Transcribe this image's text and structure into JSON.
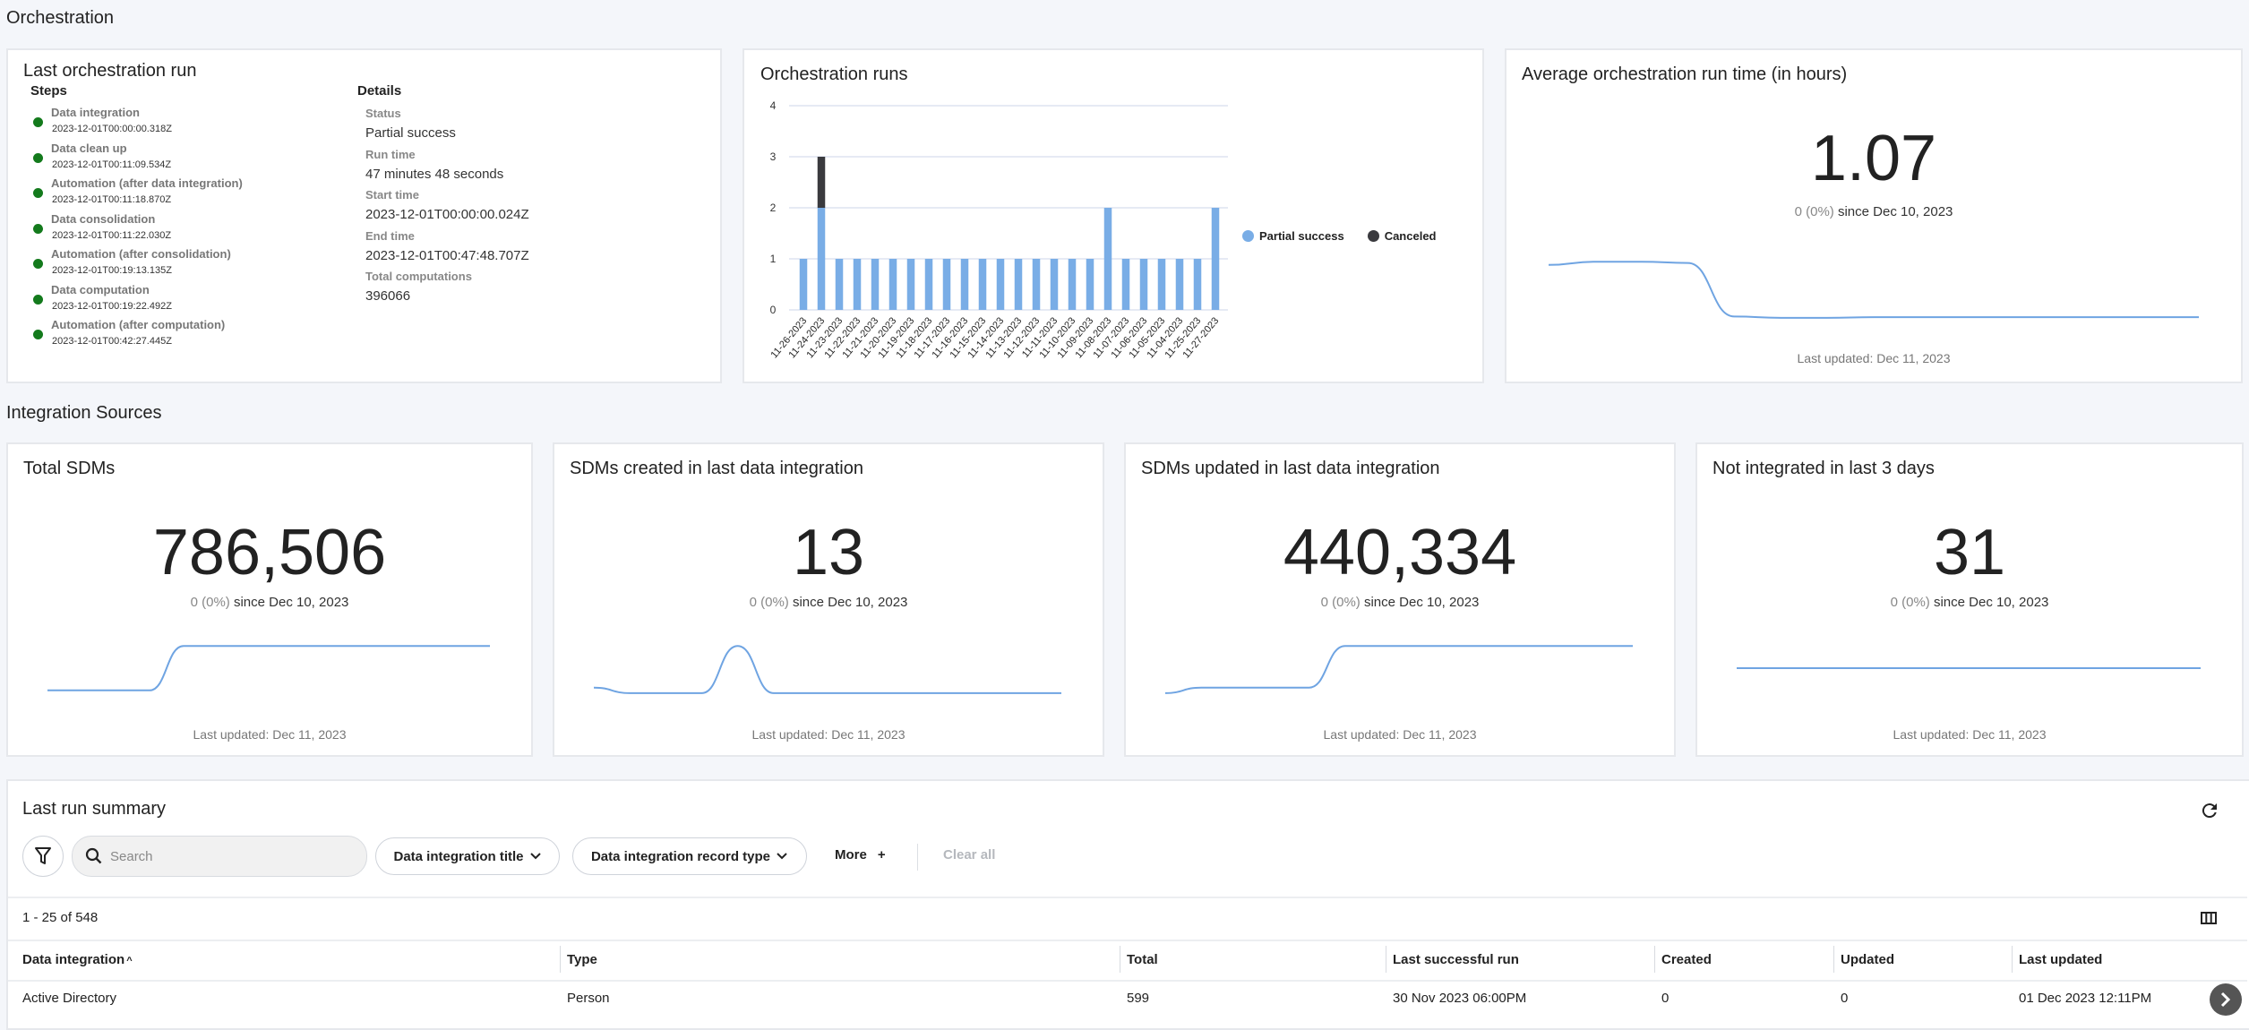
{
  "orchestration": {
    "section_title": "Orchestration",
    "last_run": {
      "title": "Last orchestration run",
      "steps_heading": "Steps",
      "steps": [
        {
          "name": "Data integration",
          "time": "2023-12-01T00:00:00.318Z",
          "status": "success"
        },
        {
          "name": "Data clean up",
          "time": "2023-12-01T00:11:09.534Z",
          "status": "success"
        },
        {
          "name": "Automation (after data integration)",
          "time": "2023-12-01T00:11:18.870Z",
          "status": "success"
        },
        {
          "name": "Data consolidation",
          "time": "2023-12-01T00:11:22.030Z",
          "status": "success"
        },
        {
          "name": "Automation (after consolidation)",
          "time": "2023-12-01T00:19:13.135Z",
          "status": "success"
        },
        {
          "name": "Data computation",
          "time": "2023-12-01T00:19:22.492Z",
          "status": "success"
        },
        {
          "name": "Automation (after computation)",
          "time": "2023-12-01T00:42:27.445Z",
          "status": "success"
        }
      ],
      "details_heading": "Details",
      "details": [
        {
          "label": "Status",
          "value": "Partial success"
        },
        {
          "label": "Run time",
          "value": "47 minutes 48 seconds"
        },
        {
          "label": "Start time",
          "value": "2023-12-01T00:00:00.024Z"
        },
        {
          "label": "End time",
          "value": "2023-12-01T00:47:48.707Z"
        },
        {
          "label": "Total computations",
          "value": "396066"
        }
      ]
    },
    "runs_chart_title": "Orchestration runs",
    "avg_runtime": {
      "title": "Average orchestration run time (in hours)",
      "value": "1.07",
      "delta": "0 (0%)",
      "since": "since Dec 10, 2023",
      "updated": "Last updated: Dec 11, 2023"
    }
  },
  "chart_data": {
    "type": "bar",
    "stacked": true,
    "title": "Orchestration runs",
    "xlabel": "",
    "ylabel": "",
    "ylim": [
      0,
      4
    ],
    "yticks": [
      0,
      1,
      2,
      3,
      4
    ],
    "grid": true,
    "legend_position": "right",
    "categories": [
      "11-26-2023",
      "11-24-2023",
      "11-23-2023",
      "11-22-2023",
      "11-21-2023",
      "11-20-2023",
      "11-19-2023",
      "11-18-2023",
      "11-17-2023",
      "11-16-2023",
      "11-15-2023",
      "11-14-2023",
      "11-13-2023",
      "11-12-2023",
      "11-11-2023",
      "11-10-2023",
      "11-09-2023",
      "11-08-2023",
      "11-07-2023",
      "11-06-2023",
      "11-05-2023",
      "11-04-2023",
      "11-25-2023",
      "11-27-2023"
    ],
    "series": [
      {
        "name": "Partial success",
        "color": "#79ade6",
        "values": [
          1,
          2,
          1,
          1,
          1,
          1,
          1,
          1,
          1,
          1,
          1,
          1,
          1,
          1,
          1,
          1,
          1,
          2,
          1,
          1,
          1,
          1,
          1,
          2
        ]
      },
      {
        "name": "Canceled",
        "color": "#3a3a3e",
        "values": [
          0,
          1,
          0,
          0,
          0,
          0,
          0,
          0,
          0,
          0,
          0,
          0,
          0,
          0,
          0,
          0,
          0,
          0,
          0,
          0,
          0,
          0,
          0,
          0
        ]
      }
    ]
  },
  "integration_sources": {
    "section_title": "Integration Sources",
    "cards": [
      {
        "title": "Total SDMs",
        "value": "786,506",
        "delta": "0 (0%)",
        "since": "since Dec 10, 2023",
        "updated": "Last updated: Dec 11, 2023",
        "trend": [
          0.1,
          0.1,
          0.1,
          0.1,
          0.9,
          0.9,
          0.9,
          0.9,
          0.9,
          0.9,
          0.9,
          0.9,
          0.9,
          0.9
        ]
      },
      {
        "title": "SDMs created in last data integration",
        "value": "13",
        "delta": "0 (0%)",
        "since": "since Dec 10, 2023",
        "updated": "Last updated: Dec 11, 2023",
        "trend": [
          0.15,
          0.05,
          0.05,
          0.05,
          0.9,
          0.05,
          0.05,
          0.05,
          0.05,
          0.05,
          0.05,
          0.05,
          0.05,
          0.05
        ]
      },
      {
        "title": "SDMs updated in last data integration",
        "value": "440,334",
        "delta": "0 (0%)",
        "since": "since Dec 10, 2023",
        "updated": "Last updated: Dec 11, 2023",
        "trend": [
          0.05,
          0.15,
          0.15,
          0.15,
          0.15,
          0.9,
          0.9,
          0.9,
          0.9,
          0.9,
          0.9,
          0.9,
          0.9,
          0.9
        ]
      },
      {
        "title": "Not integrated in last 3 days",
        "value": "31",
        "delta": "0 (0%)",
        "since": "since Dec 10, 2023",
        "updated": "Last updated: Dec 11, 2023",
        "trend": [
          0.5,
          0.5,
          0.5,
          0.5,
          0.5,
          0.5,
          0.5,
          0.5,
          0.5,
          0.5,
          0.5,
          0.5,
          0.5,
          0.5
        ]
      }
    ]
  },
  "avg_trend": [
    0.85,
    0.9,
    0.9,
    0.88,
    0.05,
    0.03,
    0.03,
    0.04,
    0.04,
    0.04,
    0.04,
    0.04,
    0.04,
    0.04,
    0.04
  ],
  "last_run_summary": {
    "title": "Last run summary",
    "search_placeholder": "Search",
    "filters": [
      "Data integration title",
      "Data integration record type"
    ],
    "more_label": "More",
    "clear_all_label": "Clear all",
    "pagination": "1 - 25 of 548",
    "columns": [
      "Data integration",
      "Type",
      "Total",
      "Last successful run",
      "Created",
      "Updated",
      "Last updated"
    ],
    "sort_indicator": "^",
    "rows": [
      [
        "Active Directory",
        "Person",
        "599",
        "30 Nov 2023 06:00PM",
        "0",
        "0",
        "01 Dec 2023 12:11PM"
      ]
    ]
  }
}
